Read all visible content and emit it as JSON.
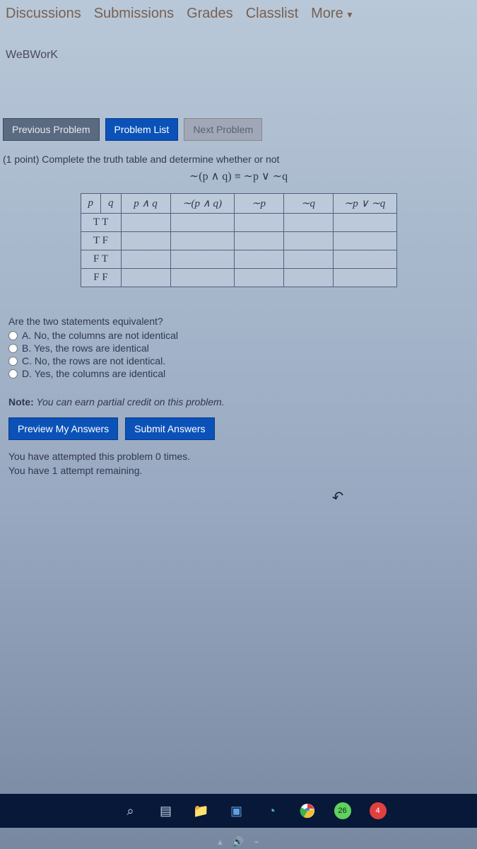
{
  "nav": {
    "discussions": "Discussions",
    "submissions": "Submissions",
    "grades": "Grades",
    "classlist": "Classlist",
    "more": "More"
  },
  "breadcrumb": "WeBWorK",
  "buttons": {
    "prev": "Previous Problem",
    "list": "Problem List",
    "next": "Next Problem",
    "preview": "Preview My Answers",
    "submit": "Submit Answers"
  },
  "problem": {
    "points_instruction": "(1 point) Complete the truth table and determine whether or not",
    "equation": "∼(p ∧ q) ≡ ∼p ∨ ∼q"
  },
  "chart_data": {
    "type": "table",
    "headers": [
      "p",
      "q",
      "p ∧ q",
      "∼(p ∧ q)",
      "∼p",
      "∼q",
      "∼p ∨ ∼q"
    ],
    "row_labels": [
      "T T",
      "T F",
      "F T",
      "F F"
    ]
  },
  "question": {
    "title": "Are the two statements equivalent?",
    "options": [
      "A. No, the columns are not identical",
      "B. Yes, the rows are identical",
      "C. No, the rows are not identical.",
      "D. Yes, the columns are identical"
    ]
  },
  "note_label": "Note:",
  "note_text": " You can earn partial credit on this problem.",
  "attempts": {
    "line1": "You have attempted this problem 0 times.",
    "line2": "You have 1 attempt remaining."
  },
  "taskbar": {
    "badge1": "26",
    "badge2": "4"
  }
}
